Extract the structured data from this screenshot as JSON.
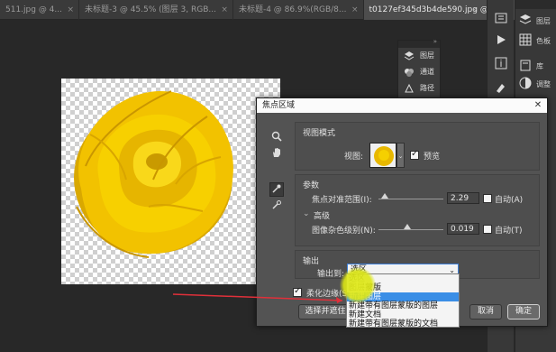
{
  "tabs": [
    {
      "label": "511.jpg @ 4...",
      "active": false
    },
    {
      "label": "未标题-3 @ 45.5% (图层 3, RGB...",
      "active": false
    },
    {
      "label": "未标题-4 @ 86.9%(RGB/8...",
      "active": false
    },
    {
      "label": "t0127ef345d3b4de590.jpg @ 100%(RGB/8)",
      "active": true
    }
  ],
  "tab_more": "»",
  "right_panel": {
    "items": [
      {
        "icon": "layers-icon",
        "label": "图层"
      },
      {
        "icon": "paths-icon",
        "label": "色板"
      },
      {
        "icon": "library-icon",
        "label": "库"
      },
      {
        "icon": "adjustments-icon",
        "label": "调整"
      }
    ]
  },
  "mini_panel": {
    "collapse": "»",
    "items": [
      {
        "icon": "layers-icon",
        "label": "图层"
      },
      {
        "icon": "channels-icon",
        "label": "通道"
      },
      {
        "icon": "paths-icon",
        "label": "路径"
      }
    ]
  },
  "dialog": {
    "title": "焦点区域",
    "close": "✕",
    "view_mode": {
      "title": "视图模式",
      "view_label": "视图:",
      "preview_label": "预览",
      "preview_checked": true
    },
    "params": {
      "title": "参数",
      "focus_range_label": "焦点对准范围(I):",
      "focus_range_value": "2.29",
      "focus_range_level": 0.1,
      "auto_a_label": "自动(A)",
      "advanced_label": "高级",
      "noise_label": "图像杂色级别(N):",
      "noise_value": "0.019",
      "noise_level": 0.45,
      "auto_t_label": "自动(T)"
    },
    "output": {
      "title": "输出",
      "output_to_label": "输出到:",
      "output_to_value": "选区",
      "soften_label": "柔化边缘(S",
      "soften_checked": true
    },
    "select_subject_btn": "选择并遮住",
    "cancel_btn": "取消",
    "ok_btn": "确定"
  },
  "dropdown_options": [
    "选区",
    "图层蒙版",
    "新建图层",
    "新建带有图层蒙版的图层",
    "新建文档",
    "新建带有图层蒙版的文档"
  ],
  "dropdown_selected_index": 2,
  "colors": {
    "highlight": "#3a8ee6",
    "flower": "#f4c400",
    "annotation_arrow": "#e0303a"
  }
}
